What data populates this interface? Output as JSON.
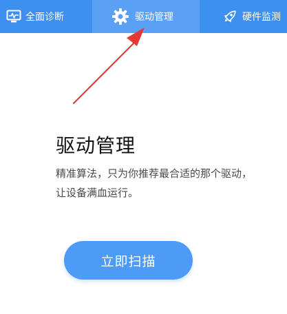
{
  "tabs": [
    {
      "label": "全面诊断",
      "icon": "monitor-pulse-icon",
      "active": false
    },
    {
      "label": "驱动管理",
      "icon": "gear-icon",
      "active": true
    },
    {
      "label": "硬件监测",
      "icon": "rocket-icon",
      "active": false
    }
  ],
  "main": {
    "title": "驱动管理",
    "desc_line1": "精准算法，只为你推荐最合适的那个驱动，",
    "desc_line2": "让设备满血运行。",
    "scan_button": "立即扫描"
  },
  "colors": {
    "tabbar_bg": "#3d8ff0",
    "active_tab_bg": "#5aa1f5",
    "button_bg": "#4d9bf7",
    "annotation_arrow": "#e53935"
  }
}
